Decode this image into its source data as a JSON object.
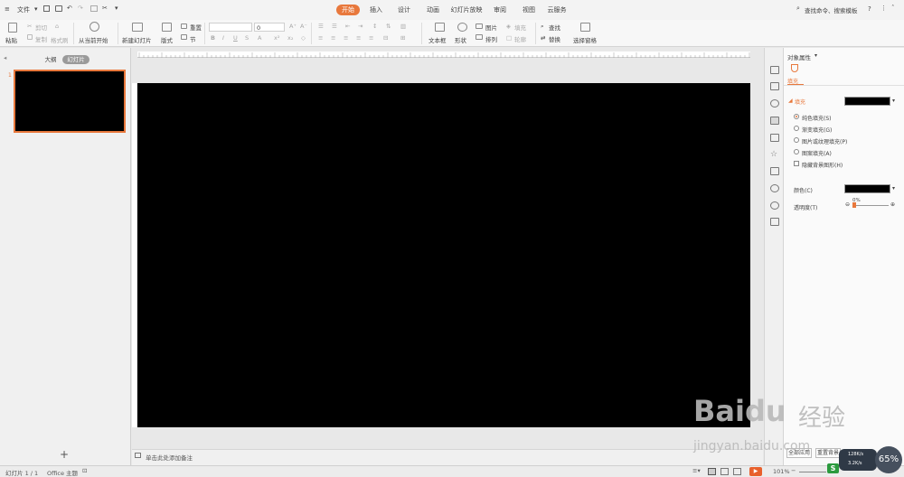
{
  "menubar": {
    "file_label": "文件",
    "tabs": [
      "开始",
      "插入",
      "设计",
      "动画",
      "幻灯片放映",
      "审阅",
      "视图",
      "云服务"
    ],
    "search_placeholder": "查找命令、搜索模板",
    "help_label": "?"
  },
  "ribbon": {
    "paste": "粘贴",
    "cut": "剪切",
    "copy": "复制",
    "format_painter": "格式刷",
    "from_current": "从当前开始",
    "new_slide": "新建幻灯片",
    "layout": "版式",
    "reset": "重置",
    "section": "节",
    "font_size_value": "0",
    "text_box": "文本框",
    "shape": "形状",
    "picture": "图片",
    "fill": "填充",
    "arrange": "排列",
    "outline": "轮廓",
    "find": "查找",
    "replace": "替换",
    "select_pane": "选择窗格"
  },
  "left_pane": {
    "tab_outline": "大纲",
    "tab_slides": "幻灯片",
    "slide_number": "1",
    "add_symbol": "+"
  },
  "notes": {
    "placeholder": "单击此处添加备注"
  },
  "props": {
    "title": "对象属性",
    "tab_fill": "填充",
    "section_fill": "填充",
    "options": [
      "纯色填充(S)",
      "渐变填充(G)",
      "图片或纹理填充(P)",
      "图案填充(A)"
    ],
    "hide_bg": "隐藏背景图形(H)",
    "color_label": "颜色(C)",
    "transparency_label": "透明度(T)",
    "transparency_value": "0%",
    "transparency_percent": 0,
    "apply_all": "全部应用",
    "reset_bg": "重置背景",
    "fill_color": "#000000"
  },
  "status": {
    "slide_counter": "幻灯片 1 / 1",
    "theme": "Office 主题",
    "zoom": "101%"
  },
  "overlay": {
    "gauge": "65%",
    "net_up": "128K/s",
    "net_down": "3.2K/s",
    "wm_brand": "Baidu",
    "wm_cn": "经验",
    "wm_url": "jingyan.baidu.com"
  },
  "colors": {
    "accent": "#e8783c",
    "slide_bg": "#000000"
  }
}
